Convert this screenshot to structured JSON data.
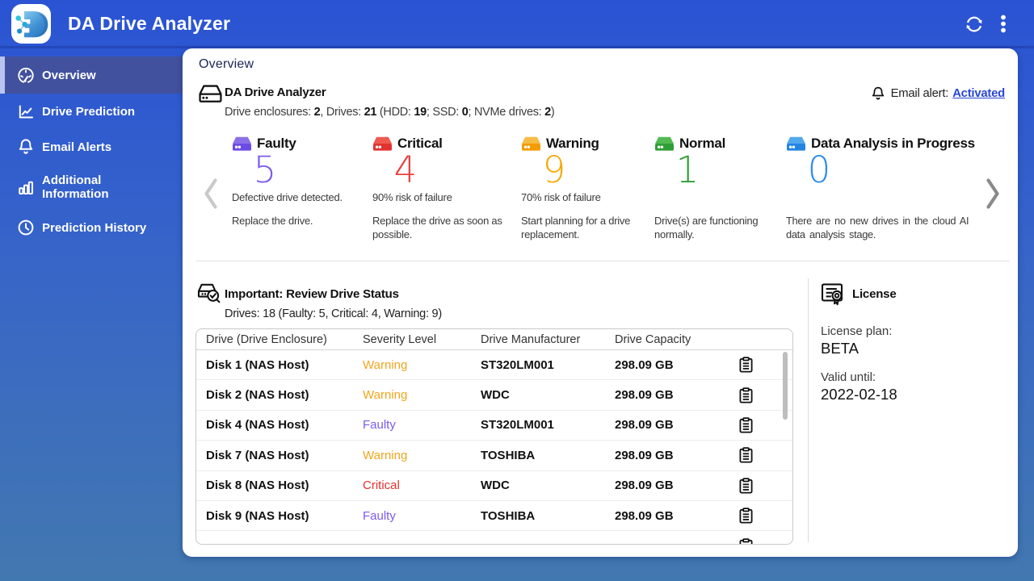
{
  "topbar": {
    "title": "DA Drive Analyzer"
  },
  "sidebar": {
    "items": [
      {
        "label": "Overview",
        "icon": "gauge-icon",
        "active": true
      },
      {
        "label": "Drive Prediction",
        "icon": "chart-line-icon",
        "active": false
      },
      {
        "label": "Email Alerts",
        "icon": "bell-icon",
        "active": false
      },
      {
        "label": "Additional Information",
        "icon": "bar-chart-icon",
        "active": false
      },
      {
        "label": "Prediction History",
        "icon": "clock-icon",
        "active": false
      }
    ]
  },
  "page": {
    "title": "Overview"
  },
  "summary": {
    "title": "DA Drive Analyzer",
    "subtitle_segments": [
      {
        "text": "Drive enclosures: "
      },
      {
        "text": "2",
        "bold": true
      },
      {
        "text": ", Drives: "
      },
      {
        "text": "21",
        "bold": true
      },
      {
        "text": " (HDD: "
      },
      {
        "text": "19",
        "bold": true
      },
      {
        "text": "; SSD: "
      },
      {
        "text": "0",
        "bold": true
      },
      {
        "text": "; NVMe drives: "
      },
      {
        "text": "2",
        "bold": true
      },
      {
        "text": ")"
      }
    ],
    "email_alert_label": "Email alert:",
    "email_alert_value": "Activated"
  },
  "status_cards": [
    {
      "label": "Faulty",
      "count": "5",
      "color": "#7C5CE8",
      "icon_front": "#6C4BE4",
      "icon_top": "#8A6FE9",
      "line1": "Defective drive detected.",
      "line2": "Replace the drive."
    },
    {
      "label": "Critical",
      "count": "4",
      "color": "#E8413C",
      "icon_front": "#E23230",
      "icon_top": "#EF5A50",
      "line1": "90% risk of failure",
      "line2": "Replace the drive as soon as possible."
    },
    {
      "label": "Warning",
      "count": "9",
      "color": "#F5A800",
      "icon_front": "#F29C00",
      "icon_top": "#F7BC45",
      "line1": "70% risk of failure",
      "line2": "Start planning for a drive replacement."
    },
    {
      "label": "Normal",
      "count": "1",
      "color": "#2E9E32",
      "icon_front": "#2E9E37",
      "icon_top": "#52BA52",
      "line1": "",
      "line2": "Drive(s) are functioning normally."
    },
    {
      "label": "Data Analysis in Progress",
      "count": "0",
      "color": "#2B8CEA",
      "icon_front": "#2384E2",
      "icon_top": "#51A8EC",
      "line1": "",
      "line2": "There are no new drives in the cloud AI data analysis stage."
    }
  ],
  "important": {
    "title": "Important: Review Drive Status",
    "subtitle": "Drives: 18 (Faulty: 5, Critical: 4, Warning: 9)",
    "table": {
      "columns": [
        "Drive (Drive Enclosure)",
        "Severity Level",
        "Drive Manufacturer",
        "Drive Capacity"
      ],
      "rows": [
        {
          "drive": "Disk 1 (NAS Host)",
          "severity": "Warning",
          "manufacturer": "ST320LM001",
          "capacity": "298.09 GB"
        },
        {
          "drive": "Disk 2 (NAS Host)",
          "severity": "Warning",
          "manufacturer": "WDC",
          "capacity": "298.09 GB"
        },
        {
          "drive": "Disk 4 (NAS Host)",
          "severity": "Faulty",
          "manufacturer": "ST320LM001",
          "capacity": "298.09 GB"
        },
        {
          "drive": "Disk 7 (NAS Host)",
          "severity": "Warning",
          "manufacturer": "TOSHIBA",
          "capacity": "298.09 GB"
        },
        {
          "drive": "Disk 8 (NAS Host)",
          "severity": "Critical",
          "manufacturer": "WDC",
          "capacity": "298.09 GB"
        },
        {
          "drive": "Disk 9 (NAS Host)",
          "severity": "Faulty",
          "manufacturer": "TOSHIBA",
          "capacity": "298.09 GB"
        },
        {
          "drive": "",
          "severity": "",
          "manufacturer": "",
          "capacity": "",
          "partial": true
        }
      ]
    }
  },
  "severity_colors": {
    "Warning": "#F0A51D",
    "Faulty": "#7A5BE8",
    "Critical": "#E3312D"
  },
  "license": {
    "title": "License",
    "plan_label": "License plan:",
    "plan": "BETA",
    "valid_label": "Valid until:",
    "valid": "2022-02-18"
  }
}
